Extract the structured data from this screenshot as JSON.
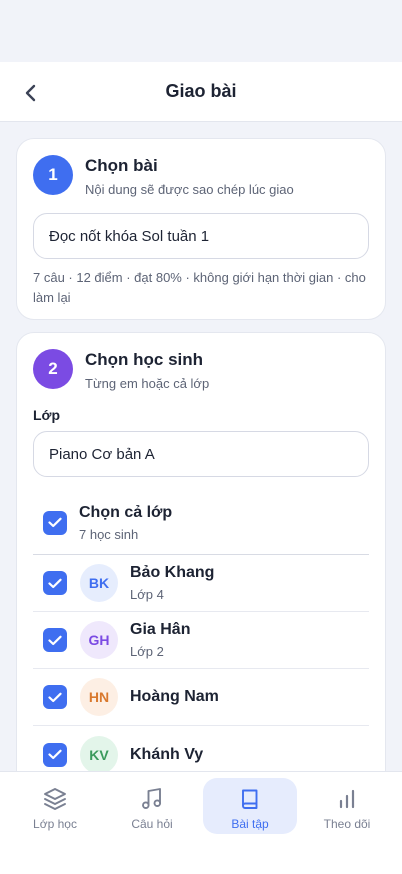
{
  "header": {
    "title": "Giao bài",
    "back_icon": "chevron-left-icon"
  },
  "step1": {
    "number": "1",
    "title": "Chọn bài",
    "subtitle": "Nội dung sẽ được sao chép lúc giao",
    "selected_lesson": "Đọc nốt khóa Sol tuần 1",
    "meta": "7 câu · 12 điểm · đạt 80% · không giới hạn thời gian · cho làm lại",
    "color": "#3f6ef0"
  },
  "step2": {
    "number": "2",
    "title": "Chọn học sinh",
    "subtitle": "Từng em hoặc cả lớp",
    "class_label": "Lớp",
    "class_value": "Piano Cơ bản A",
    "color": "#7b4be3",
    "select_all": {
      "label": "Chọn cả lớp",
      "count": "7 học sinh",
      "checked": true
    },
    "students": [
      {
        "initials": "BK",
        "name": "Bảo Khang",
        "grade": "Lớp 4",
        "checked": true,
        "bg": "#e6edfd",
        "fg": "#3f6ef0"
      },
      {
        "initials": "GH",
        "name": "Gia Hân",
        "grade": "Lớp 2",
        "checked": true,
        "bg": "#efe8fc",
        "fg": "#7b4be3"
      },
      {
        "initials": "HN",
        "name": "Hoàng Nam",
        "grade": "",
        "checked": true,
        "bg": "#fdefe4",
        "fg": "#d9792e"
      },
      {
        "initials": "KV",
        "name": "Khánh Vy",
        "grade": "",
        "checked": true,
        "bg": "#e3f5ea",
        "fg": "#3a9a5c"
      }
    ]
  },
  "tabs": [
    {
      "label": "Lớp học",
      "icon": "layers-icon",
      "active": false
    },
    {
      "label": "Câu hỏi",
      "icon": "music-note-icon",
      "active": false
    },
    {
      "label": "Bài tập",
      "icon": "book-icon",
      "active": true
    },
    {
      "label": "Theo dõi",
      "icon": "bar-chart-icon",
      "active": false
    }
  ],
  "colors": {
    "accent": "#3f6ef0",
    "background": "#f1f3f9",
    "text": "#1d2333"
  }
}
